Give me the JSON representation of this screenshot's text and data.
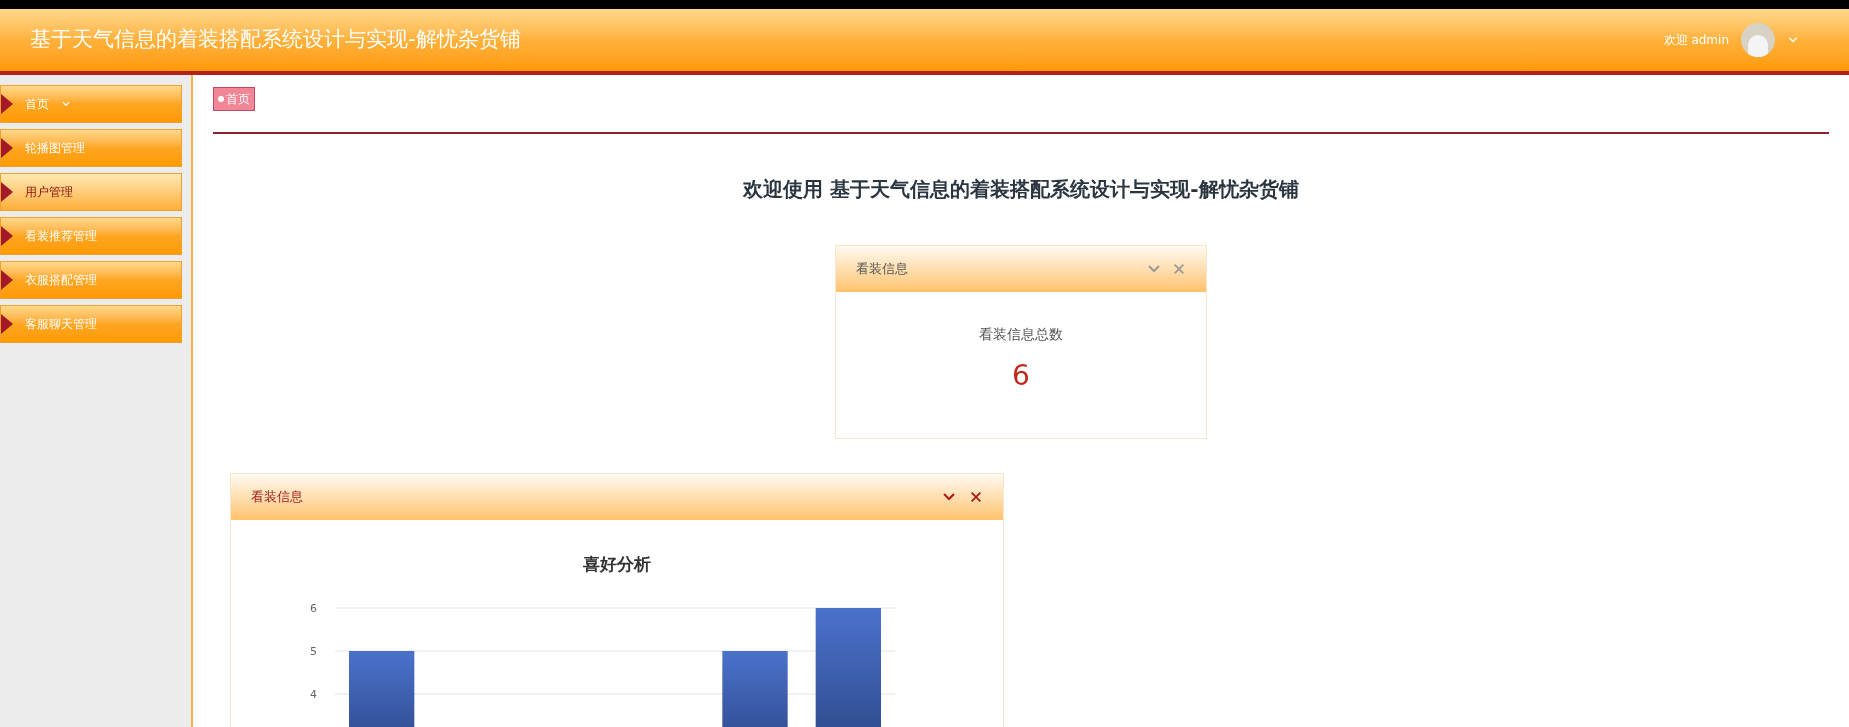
{
  "header": {
    "title": "基于天气信息的着装搭配系统设计与实现-解忧杂货铺",
    "greeting": "欢迎 admin"
  },
  "sidebar": {
    "items": [
      {
        "label": "首页",
        "has_dropdown": true,
        "highlighted": false
      },
      {
        "label": "轮播图管理",
        "has_dropdown": false,
        "highlighted": false
      },
      {
        "label": "用户管理",
        "has_dropdown": false,
        "highlighted": true
      },
      {
        "label": "看装推荐管理",
        "has_dropdown": false,
        "highlighted": false
      },
      {
        "label": "衣服搭配管理",
        "has_dropdown": false,
        "highlighted": false
      },
      {
        "label": "客服聊天管理",
        "has_dropdown": false,
        "highlighted": false
      }
    ]
  },
  "breadcrumb": [
    "首页"
  ],
  "welcome": "欢迎使用 基于天气信息的着装搭配系统设计与实现-解忧杂货铺",
  "stat_card": {
    "title": "看装信息",
    "label": "看装信息总数",
    "value": "6"
  },
  "chart_card": {
    "title": "看装信息",
    "chart_data": {
      "type": "bar",
      "title": "喜好分析",
      "values": [
        5,
        null,
        null,
        null,
        5,
        6
      ],
      "ylim": [
        2.5,
        6
      ],
      "yticks": [
        4,
        5,
        6
      ]
    }
  }
}
